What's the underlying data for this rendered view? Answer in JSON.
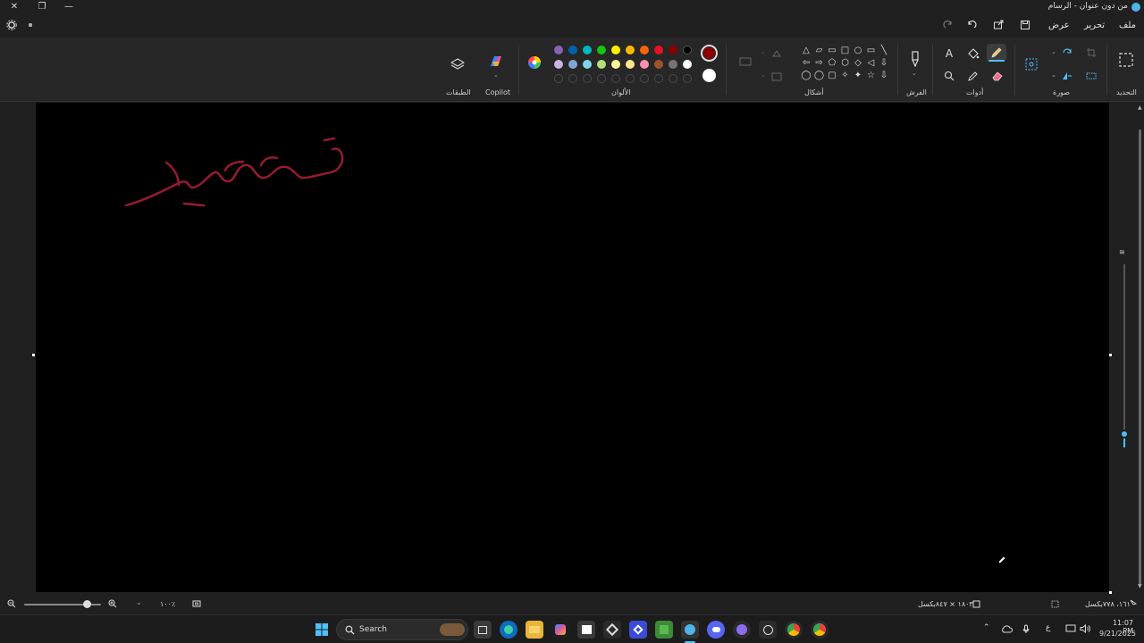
{
  "window": {
    "title": "من دون عنوان - الرسام",
    "close_glyph": "✕",
    "restore_glyph": "❐",
    "minimize_glyph": "—"
  },
  "menu": {
    "file": "ملف",
    "edit": "تحرير",
    "view": "عرض"
  },
  "ribbon": {
    "groups": {
      "selection": "التحديد",
      "image": "صورة",
      "tools": "أدوات",
      "brushes": "الفرش",
      "shapes": "أشكال",
      "colors": "الألوان",
      "copilot": "Copilot",
      "layers": "الطبقات"
    },
    "active_color": "#8b0000",
    "secondary_color": "#ffffff",
    "palette_row1": [
      "#000000",
      "#8b0000",
      "#e81123",
      "#f7630c",
      "#ffb900",
      "#ffee00",
      "#16c60c",
      "#00b7c3",
      "#0063b1",
      "#8764b8"
    ],
    "palette_row2": [
      "#ffffff",
      "#7a7574",
      "#a0522d",
      "#ff8fb1",
      "#fde68a",
      "#fff59d",
      "#b4e07a",
      "#7fd6e8",
      "#7ea7d8",
      "#c6b3e3"
    ]
  },
  "canvas": {
    "stroke_color": "#9b1b30",
    "stroke_label": "drawn handwriting stroke"
  },
  "status": {
    "cursor_pos": "١٦١، ٧٧٨بكسل",
    "canvas_size": "١٨٠٣ × ٨٤٧بكسل",
    "zoom": "١٠٠٪"
  },
  "taskbar": {
    "search_label": "Search",
    "time": "11:07 PM",
    "date": "9/21/2025",
    "lang": "ع"
  }
}
